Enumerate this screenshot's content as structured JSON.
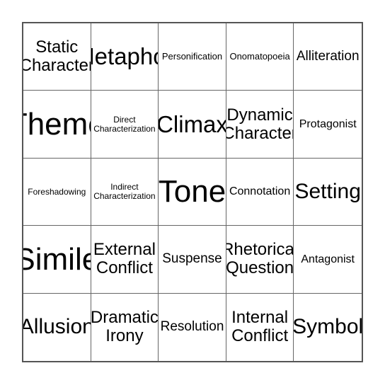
{
  "card": {
    "type": "bingo-card",
    "rows": 5,
    "columns": 5,
    "border_color": "#555555",
    "grid_line_color": "#666666",
    "background_color": "#ffffff",
    "text_color": "#000000",
    "cells": [
      {
        "label": "Static Character",
        "size": "md"
      },
      {
        "label": "Metaphor",
        "size": "xl"
      },
      {
        "label": "Personification",
        "size": "xxs"
      },
      {
        "label": "Onomatopoeia",
        "size": "xxs"
      },
      {
        "label": "Alliteration",
        "size": "sm"
      },
      {
        "label": "Theme",
        "size": "xxl"
      },
      {
        "label": "Direct Characterization",
        "size": "tiny"
      },
      {
        "label": "Climax",
        "size": "xl"
      },
      {
        "label": "Dynamic Character",
        "size": "md"
      },
      {
        "label": "Protagonist",
        "size": "xs"
      },
      {
        "label": "Foreshadowing",
        "size": "tiny"
      },
      {
        "label": "Indirect Characterization",
        "size": "tiny"
      },
      {
        "label": "Tone",
        "size": "xxl"
      },
      {
        "label": "Connotation",
        "size": "xs"
      },
      {
        "label": "Setting",
        "size": "lg"
      },
      {
        "label": "Simile",
        "size": "xxl"
      },
      {
        "label": "External Conflict",
        "size": "md"
      },
      {
        "label": "Suspense",
        "size": "sm"
      },
      {
        "label": "Rhetorical Question",
        "size": "md"
      },
      {
        "label": "Antagonist",
        "size": "xs"
      },
      {
        "label": "Allusion",
        "size": "lg"
      },
      {
        "label": "Dramatic Irony",
        "size": "md"
      },
      {
        "label": "Resolution",
        "size": "sm"
      },
      {
        "label": "Internal Conflict",
        "size": "md"
      },
      {
        "label": "Symbol",
        "size": "lg"
      }
    ]
  }
}
